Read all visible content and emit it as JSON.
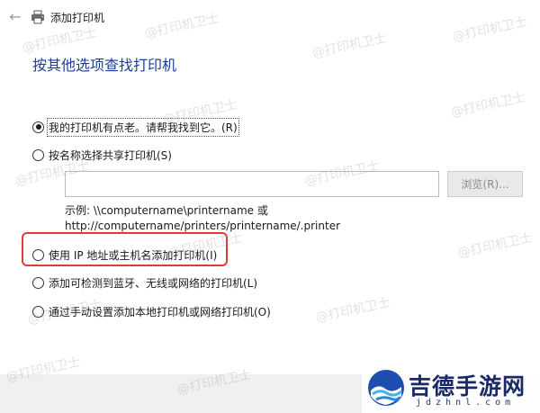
{
  "window": {
    "title": "添加打印机",
    "back_icon": "back-arrow-icon",
    "title_icon": "printer-icon"
  },
  "heading": "按其他选项查找打印机",
  "options": [
    {
      "label": "我的打印机有点老。请帮我找到它。(R)",
      "checked": true
    },
    {
      "label": "按名称选择共享打印机(S)",
      "checked": false
    },
    {
      "label": "使用 IP 地址或主机名添加打印机(I)",
      "checked": false
    },
    {
      "label": "添加可检测到蓝牙、无线或网络的打印机(L)",
      "checked": false
    },
    {
      "label": "通过手动设置添加本地打印机或网络打印机(O)",
      "checked": false
    }
  ],
  "share_input": {
    "value": ""
  },
  "browse_button": {
    "label": "浏览(R)..."
  },
  "example": {
    "line1": "示例: \\\\computername\\printername 或",
    "line2": "http://computername/printers/printername/.printer"
  },
  "watermark": {
    "text": "@打印机卫士"
  },
  "site_badge": {
    "name": "吉德手游网",
    "url": "jdzhnl.com"
  },
  "colors": {
    "heading": "#1c3f95",
    "highlight": "#e53935",
    "footer": "#f0f0f0"
  }
}
